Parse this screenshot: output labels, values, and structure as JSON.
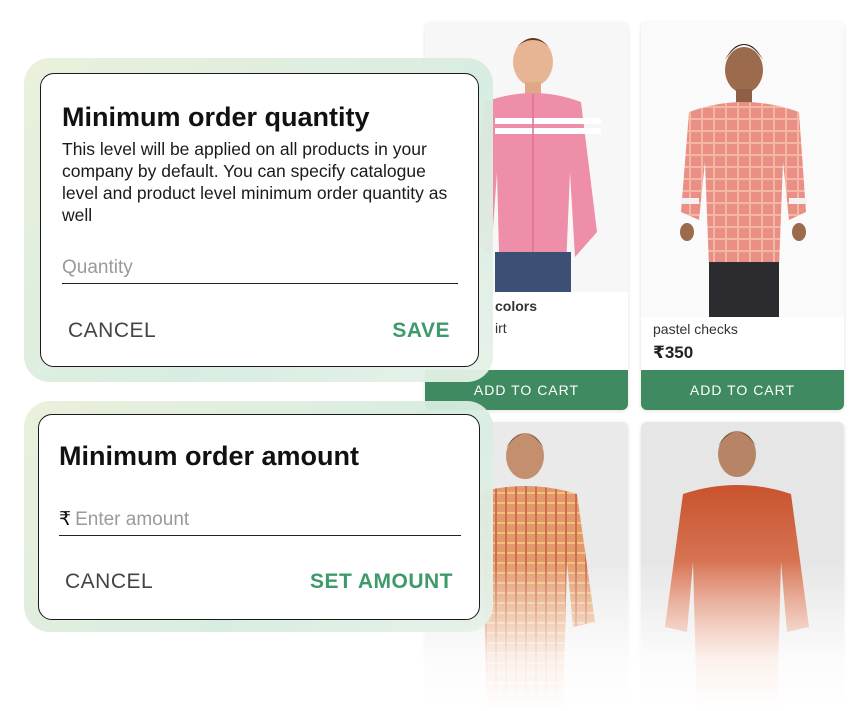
{
  "products": [
    {
      "name_prefix": "colors",
      "name": "irt",
      "add_label": "ADD TO CART"
    },
    {
      "name": "pastel checks",
      "price": "₹350",
      "add_label": "ADD TO CART"
    }
  ],
  "min_qty_dialog": {
    "title": "Minimum order quantity",
    "description": "This level will be applied on all products in your company by default. You can specify catalogue level and product level minimum order quantity as well",
    "placeholder": "Quantity",
    "cancel_label": "CANCEL",
    "save_label": "SAVE"
  },
  "min_amount_dialog": {
    "title": "Minimum order amount",
    "currency_symbol": "₹",
    "placeholder": "Enter amount",
    "cancel_label": "CANCEL",
    "set_label": "SET AMOUNT"
  },
  "colors": {
    "accent_green": "#3f8a60",
    "primary_text_green": "#3f9a6b",
    "pink_shirt": "#ee8ea8",
    "check_shirt": "#e58a7c",
    "orange_shirt": "#d9663f"
  }
}
